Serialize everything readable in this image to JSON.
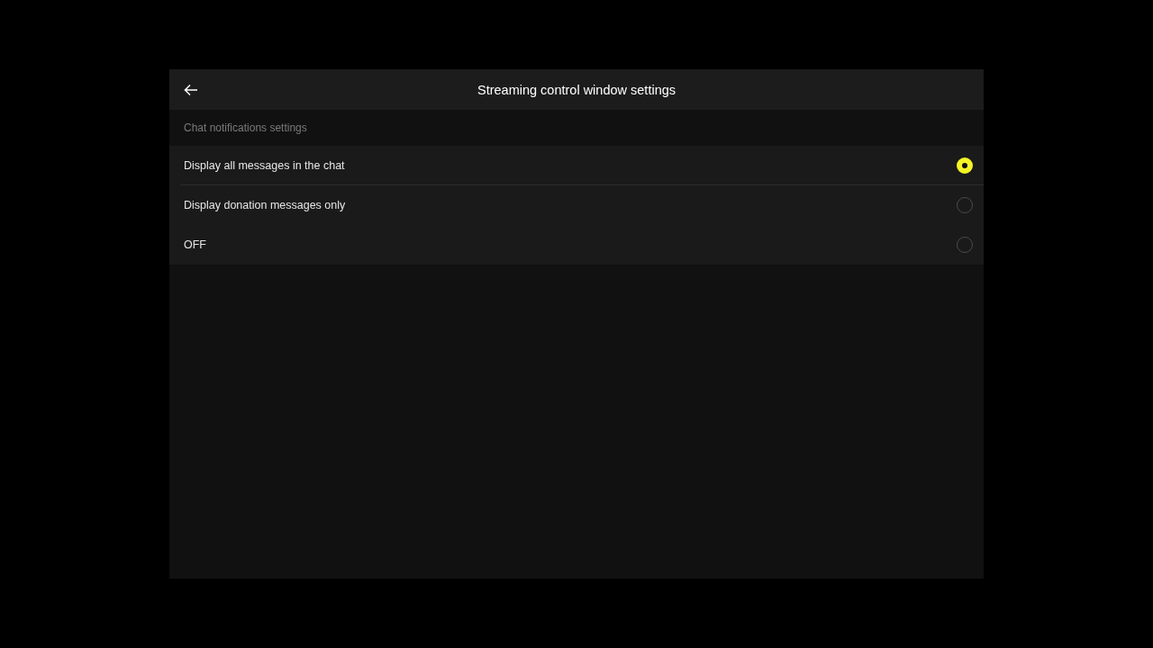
{
  "window": {
    "title": "Streaming control window settings"
  },
  "section": {
    "label": "Chat notifications settings"
  },
  "options": [
    {
      "label": "Display all messages in the chat",
      "selected": true
    },
    {
      "label": "Display donation messages only",
      "selected": false
    },
    {
      "label": "OFF",
      "selected": false
    }
  ]
}
